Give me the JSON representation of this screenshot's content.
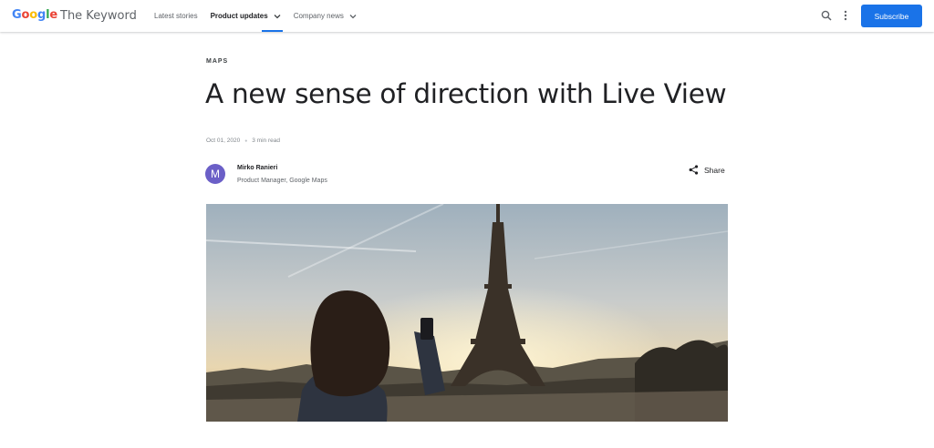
{
  "header": {
    "logo_letters": [
      {
        "char": "G",
        "color": "#4285F4"
      },
      {
        "char": "o",
        "color": "#EA4335"
      },
      {
        "char": "o",
        "color": "#FBBC05"
      },
      {
        "char": "g",
        "color": "#4285F4"
      },
      {
        "char": "l",
        "color": "#34A853"
      },
      {
        "char": "e",
        "color": "#EA4335"
      }
    ],
    "site_title": "The Keyword",
    "nav": [
      {
        "label": "Latest stories"
      },
      {
        "label": "Product updates",
        "active": true,
        "dropdown": true
      },
      {
        "label": "Company news",
        "dropdown": true
      }
    ],
    "search_icon": "search-icon",
    "more_icon": "more-vert-icon",
    "subscribe_label": "Subscribe",
    "accent_color": "#1a73e8"
  },
  "article": {
    "eyebrow": "MAPS",
    "title": "A new sense of direction with Live View",
    "date": "Oct 01, 2020",
    "read_time": "3 min read",
    "author": {
      "initial": "M",
      "name": "Mirko Ranieri",
      "role": "Product Manager, Google Maps",
      "avatar_color": "#6b5fc7"
    },
    "share_label": "Share",
    "hero_image": "eiffel-tower-photo"
  }
}
